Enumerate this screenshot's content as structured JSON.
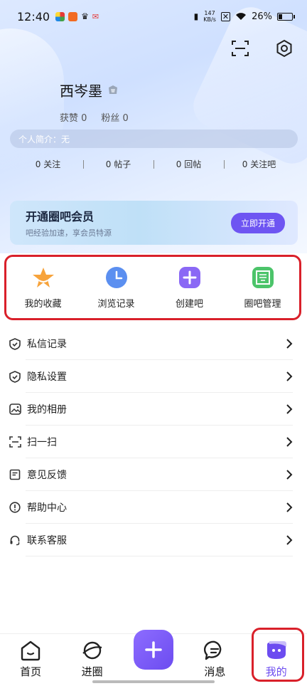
{
  "status_bar": {
    "time": "12:40",
    "speed_value": "147",
    "speed_unit": "KB/s",
    "battery": "26%"
  },
  "profile": {
    "username": "西岑墨",
    "likes": "获赞 0",
    "fans": "粉丝 0",
    "bio": "个人简介：无"
  },
  "counts": [
    {
      "label": "0 关注"
    },
    {
      "label": "0 帖子"
    },
    {
      "label": "0 回帖"
    },
    {
      "label": "0 关注吧"
    }
  ],
  "vip": {
    "title": "开通圈吧会员",
    "subtitle": "吧经验加速，享会员特源",
    "button": "立即开通"
  },
  "quick_actions": [
    {
      "label": "我的收藏",
      "icon": "star-icon"
    },
    {
      "label": "浏览记录",
      "icon": "clock-icon"
    },
    {
      "label": "创建吧",
      "icon": "plus-icon"
    },
    {
      "label": "圈吧管理",
      "icon": "quan-icon"
    }
  ],
  "menu": [
    {
      "label": "私信记录",
      "icon": "shield-icon"
    },
    {
      "label": "隐私设置",
      "icon": "shield-check-icon"
    },
    {
      "label": "我的相册",
      "icon": "image-icon"
    },
    {
      "label": "扫一扫",
      "icon": "scan-icon"
    },
    {
      "label": "意见反馈",
      "icon": "feedback-icon"
    },
    {
      "label": "帮助中心",
      "icon": "info-icon"
    },
    {
      "label": "联系客服",
      "icon": "headset-icon"
    }
  ],
  "nav": {
    "home": "首页",
    "circle": "进圈",
    "messages": "消息",
    "me": "我的"
  },
  "colors": {
    "accent": "#6c4cf0",
    "highlight": "#d9202a"
  }
}
